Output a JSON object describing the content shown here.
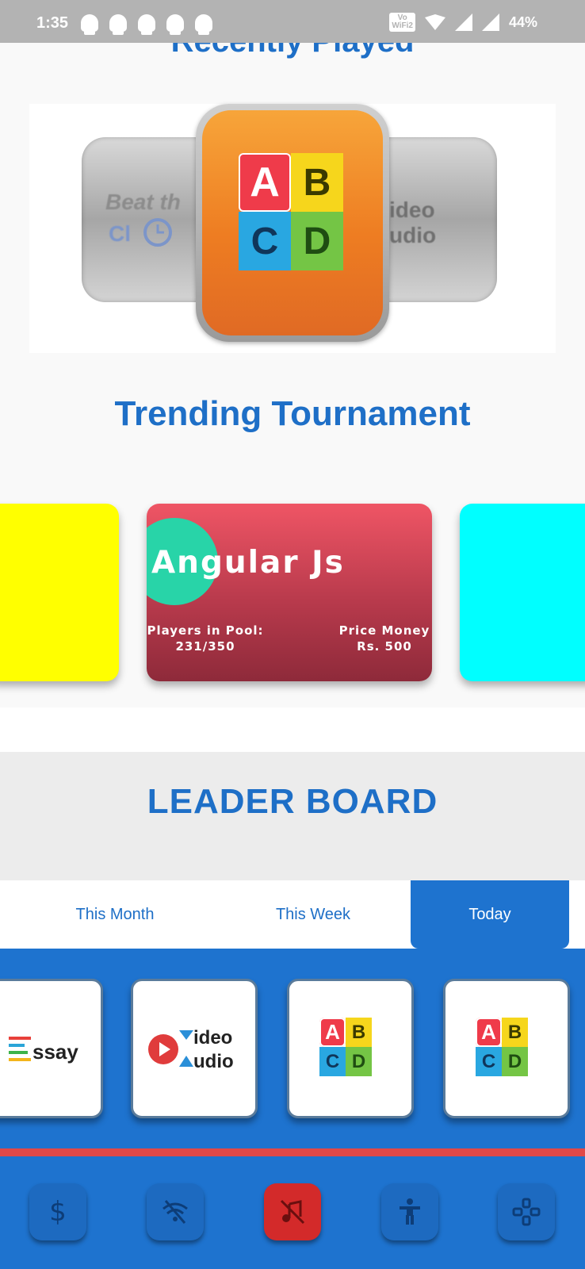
{
  "status_bar": {
    "time": "1:35",
    "volte": "Vo\nWiFi 2",
    "battery": "44%"
  },
  "recently_played": {
    "title": "Recently Played",
    "left_card_text": "Beat th",
    "left_card_text2": "Cl",
    "right_card_text": "ideo",
    "right_card_text2": "udio",
    "center_tiles": [
      "A",
      "B",
      "C",
      "D"
    ]
  },
  "trending": {
    "title": "Trending Tournament",
    "card": {
      "name": "Angular Js",
      "players_label": "Players in Pool:",
      "players_value": "231/350",
      "prize_label": "Price Money",
      "prize_value": "Rs. 500"
    },
    "colors": {
      "left": "#ffff00",
      "right": "#00ffff"
    }
  },
  "leaderboard": {
    "title": "LEADER  BOARD",
    "tabs": [
      "This Month",
      "This Week",
      "Today"
    ],
    "active_tab": "Today"
  },
  "games": {
    "essay_label": "ssay",
    "essay_letter": "E",
    "video_label": "ideo",
    "audio_label": "udio",
    "tiles": [
      "A",
      "B",
      "C",
      "D"
    ]
  },
  "bottom_nav": {
    "items": [
      "dollar-icon",
      "wifi-off-icon",
      "music-off-icon",
      "accessibility-icon",
      "gamepad-icon"
    ],
    "active_index": 2
  },
  "colors": {
    "accent": "#1e6fc7",
    "nav_bg": "#1e73cf",
    "active": "#d32a2a",
    "divider": "#e04848"
  }
}
